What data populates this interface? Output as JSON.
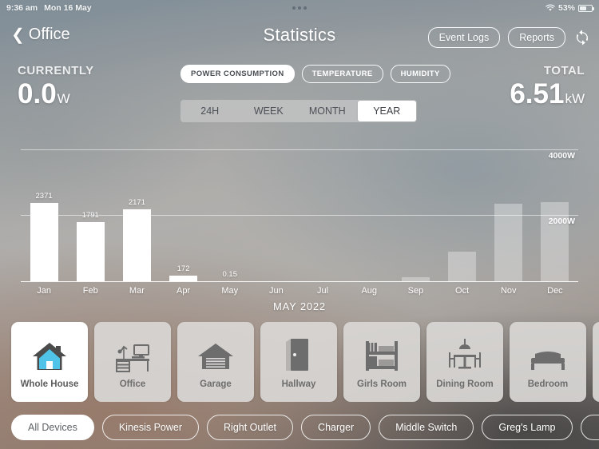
{
  "statusbar": {
    "time": "9:36 am",
    "date": "Mon 16 May",
    "battery_percent": "53%",
    "wifi_icon": "wifi-icon",
    "battery_icon": "battery-icon"
  },
  "navbar": {
    "back_label": "Office",
    "back_icon": "chevron-left-icon",
    "title": "Statistics",
    "event_logs_label": "Event Logs",
    "reports_label": "Reports",
    "refresh_icon": "refresh-icon"
  },
  "summary": {
    "currently_label": "CURRENTLY",
    "currently_value": "0.0",
    "currently_unit": "W",
    "total_label": "TOTAL",
    "total_value": "6.51",
    "total_unit": "kW"
  },
  "metrics": [
    {
      "label": "POWER CONSUMPTION",
      "active": true
    },
    {
      "label": "TEMPERATURE",
      "active": false
    },
    {
      "label": "HUMIDITY",
      "active": false
    }
  ],
  "ranges": [
    {
      "label": "24H",
      "active": false
    },
    {
      "label": "WEEK",
      "active": false
    },
    {
      "label": "MONTH",
      "active": false
    },
    {
      "label": "YEAR",
      "active": true
    }
  ],
  "chart_data": {
    "type": "bar",
    "title": "",
    "xlabel": "",
    "ylabel": "",
    "ylim": [
      0,
      4400
    ],
    "grid": true,
    "gridlines": [
      {
        "value": 4000,
        "label": "4000W"
      },
      {
        "value": 2000,
        "label": "2000W"
      }
    ],
    "categories": [
      "Jan",
      "Feb",
      "Mar",
      "Apr",
      "May",
      "Jun",
      "Jul",
      "Aug",
      "Sep",
      "Oct",
      "Nov",
      "Dec"
    ],
    "values": [
      2371,
      1791,
      2171,
      172,
      0.15,
      0,
      0,
      0,
      130,
      900,
      2340,
      2400
    ],
    "value_labels": [
      "2371",
      "1791",
      "2171",
      "172",
      "0.15",
      "",
      "",
      "",
      "",
      "",
      "",
      ""
    ],
    "faded": [
      false,
      false,
      false,
      false,
      false,
      false,
      false,
      false,
      true,
      true,
      true,
      true
    ],
    "legend": [],
    "period_label": "MAY 2022"
  },
  "rooms": [
    {
      "label": "Whole House",
      "icon": "house-icon",
      "active": true
    },
    {
      "label": "Office",
      "icon": "desk-icon",
      "active": false
    },
    {
      "label": "Garage",
      "icon": "garage-icon",
      "active": false
    },
    {
      "label": "Hallway",
      "icon": "door-icon",
      "active": false
    },
    {
      "label": "Girls Room",
      "icon": "bunk-bed-icon",
      "active": false
    },
    {
      "label": "Dining Room",
      "icon": "dining-table-icon",
      "active": false
    },
    {
      "label": "Bedroom",
      "icon": "bed-icon",
      "active": false
    },
    {
      "label": "",
      "icon": "partial-room-icon",
      "active": false
    }
  ],
  "devices": [
    {
      "label": "All Devices",
      "active": true
    },
    {
      "label": "Kinesis Power",
      "active": false
    },
    {
      "label": "Right Outlet",
      "active": false
    },
    {
      "label": "Charger",
      "active": false
    },
    {
      "label": "Middle Switch",
      "active": false
    },
    {
      "label": "Greg's Lamp",
      "active": false
    },
    {
      "label": "",
      "active": false
    }
  ],
  "colors": {
    "accent_blue": "#4FC3E8",
    "icon_gray": "#6d6d6d",
    "bar_white": "#ffffff"
  }
}
